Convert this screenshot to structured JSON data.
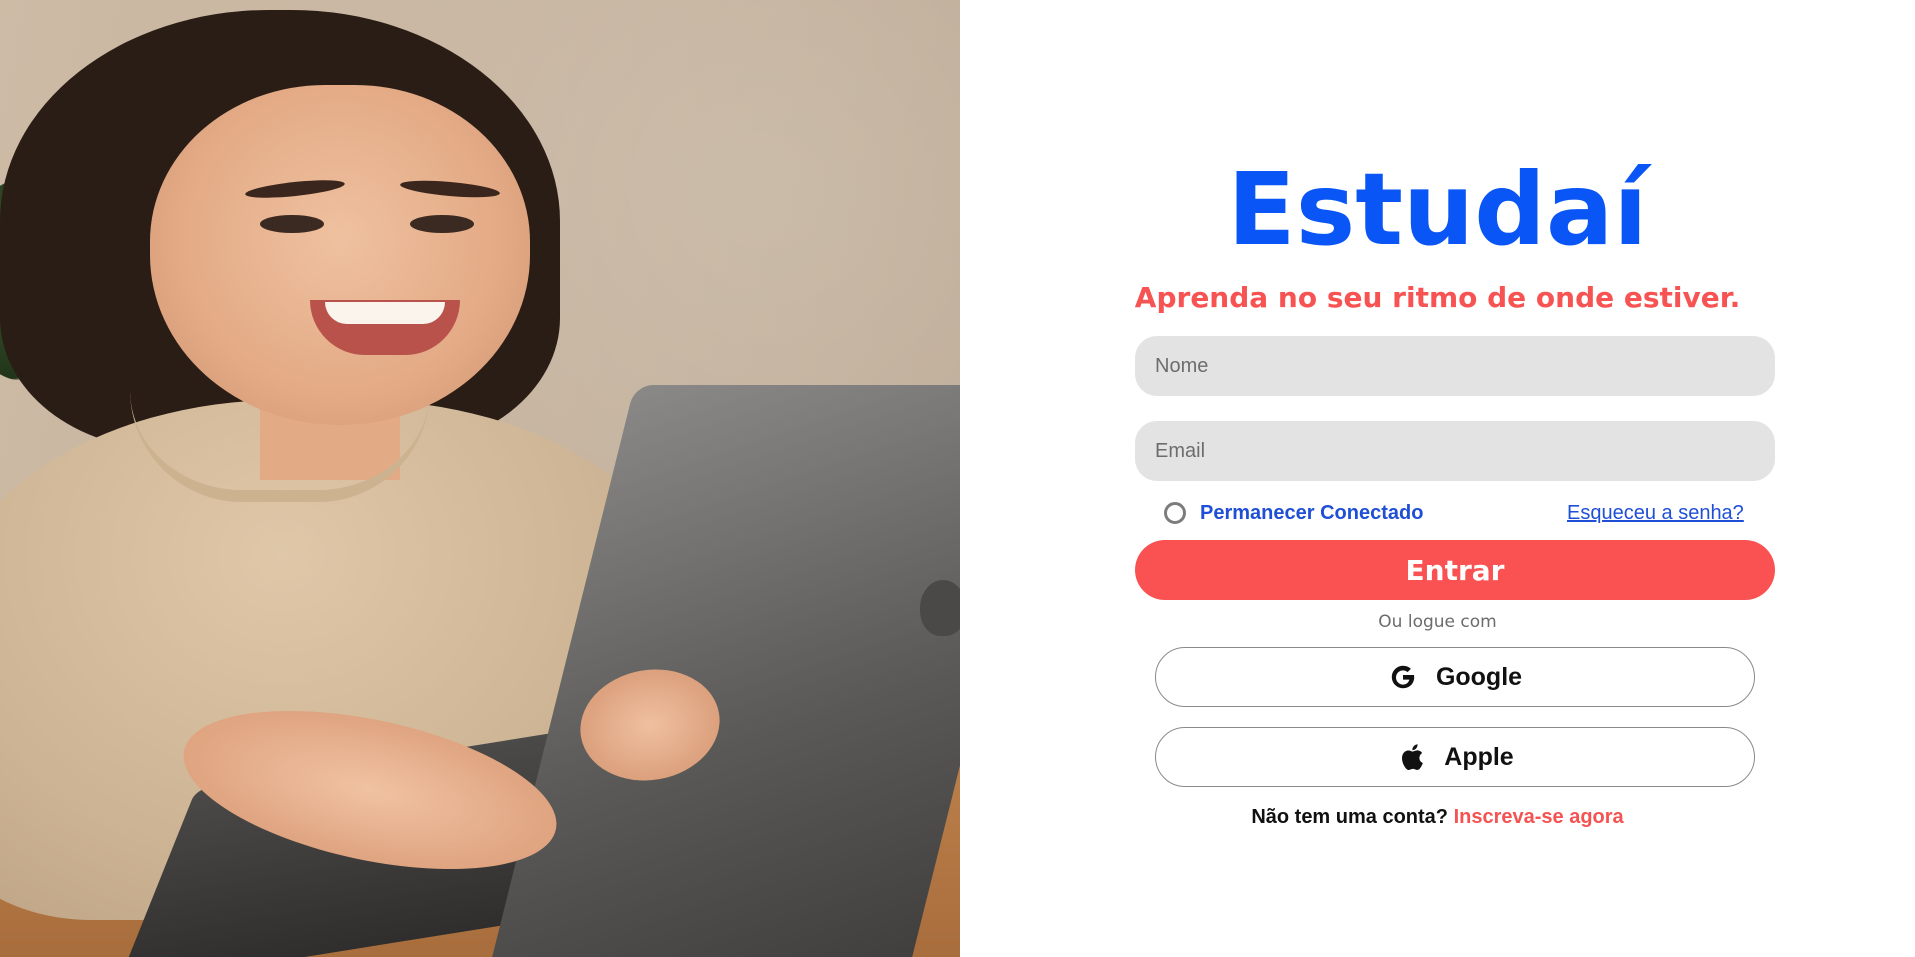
{
  "brand": {
    "name": "Estudaí",
    "tagline": "Aprenda no seu ritmo de onde estiver.",
    "primary_color": "#0a55f5",
    "accent_color": "#fa5252"
  },
  "hero_image": {
    "description_icon": "photo-woman-laptop"
  },
  "form": {
    "name_placeholder": "Nome",
    "email_placeholder": "Email",
    "remember_label": "Permanecer Conectado",
    "remember_checked": false,
    "forgot_link": "Esqueceu a senha?",
    "submit_label": "Entrar"
  },
  "social": {
    "divider_text": "Ou logue com",
    "buttons": [
      {
        "label": "Google",
        "icon": "google-icon"
      },
      {
        "label": "Apple",
        "icon": "apple-icon"
      }
    ]
  },
  "signup": {
    "prompt": "Não tem uma conta?",
    "link": "Inscreva-se agora"
  }
}
